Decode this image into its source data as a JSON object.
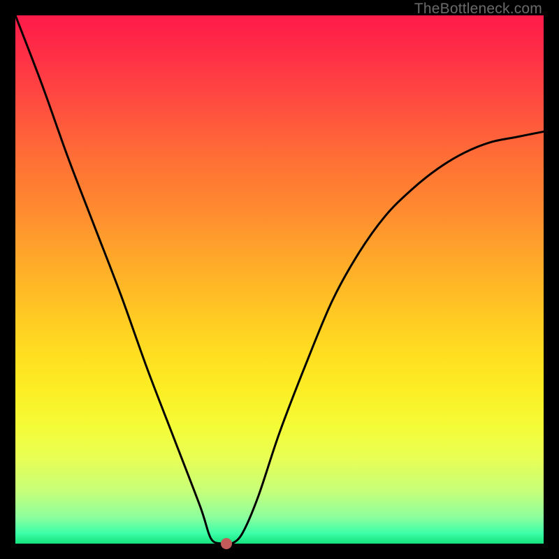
{
  "watermark": {
    "text": "TheBottleneck.com"
  },
  "chart_data": {
    "type": "line",
    "title": "",
    "xlabel": "",
    "ylabel": "",
    "xlim": [
      0,
      100
    ],
    "ylim": [
      0,
      100
    ],
    "grid": false,
    "series": [
      {
        "name": "bottleneck-curve",
        "x": [
          0,
          5,
          10,
          15,
          20,
          25,
          30,
          35,
          37,
          39,
          40,
          41,
          43,
          46,
          50,
          55,
          60,
          65,
          70,
          75,
          80,
          85,
          90,
          95,
          100
        ],
        "y": [
          100,
          87,
          73,
          60,
          47,
          33,
          20,
          7,
          1,
          0,
          0,
          0,
          2,
          9,
          21,
          34,
          46,
          55,
          62,
          67,
          71,
          74,
          76,
          77,
          78
        ]
      }
    ],
    "point": {
      "x": 40,
      "y": 0,
      "color": "#c25b5a"
    },
    "background_gradient": {
      "top": "#ff1a4a",
      "mid": "#fcee24",
      "bottom": "#14e37e"
    }
  }
}
